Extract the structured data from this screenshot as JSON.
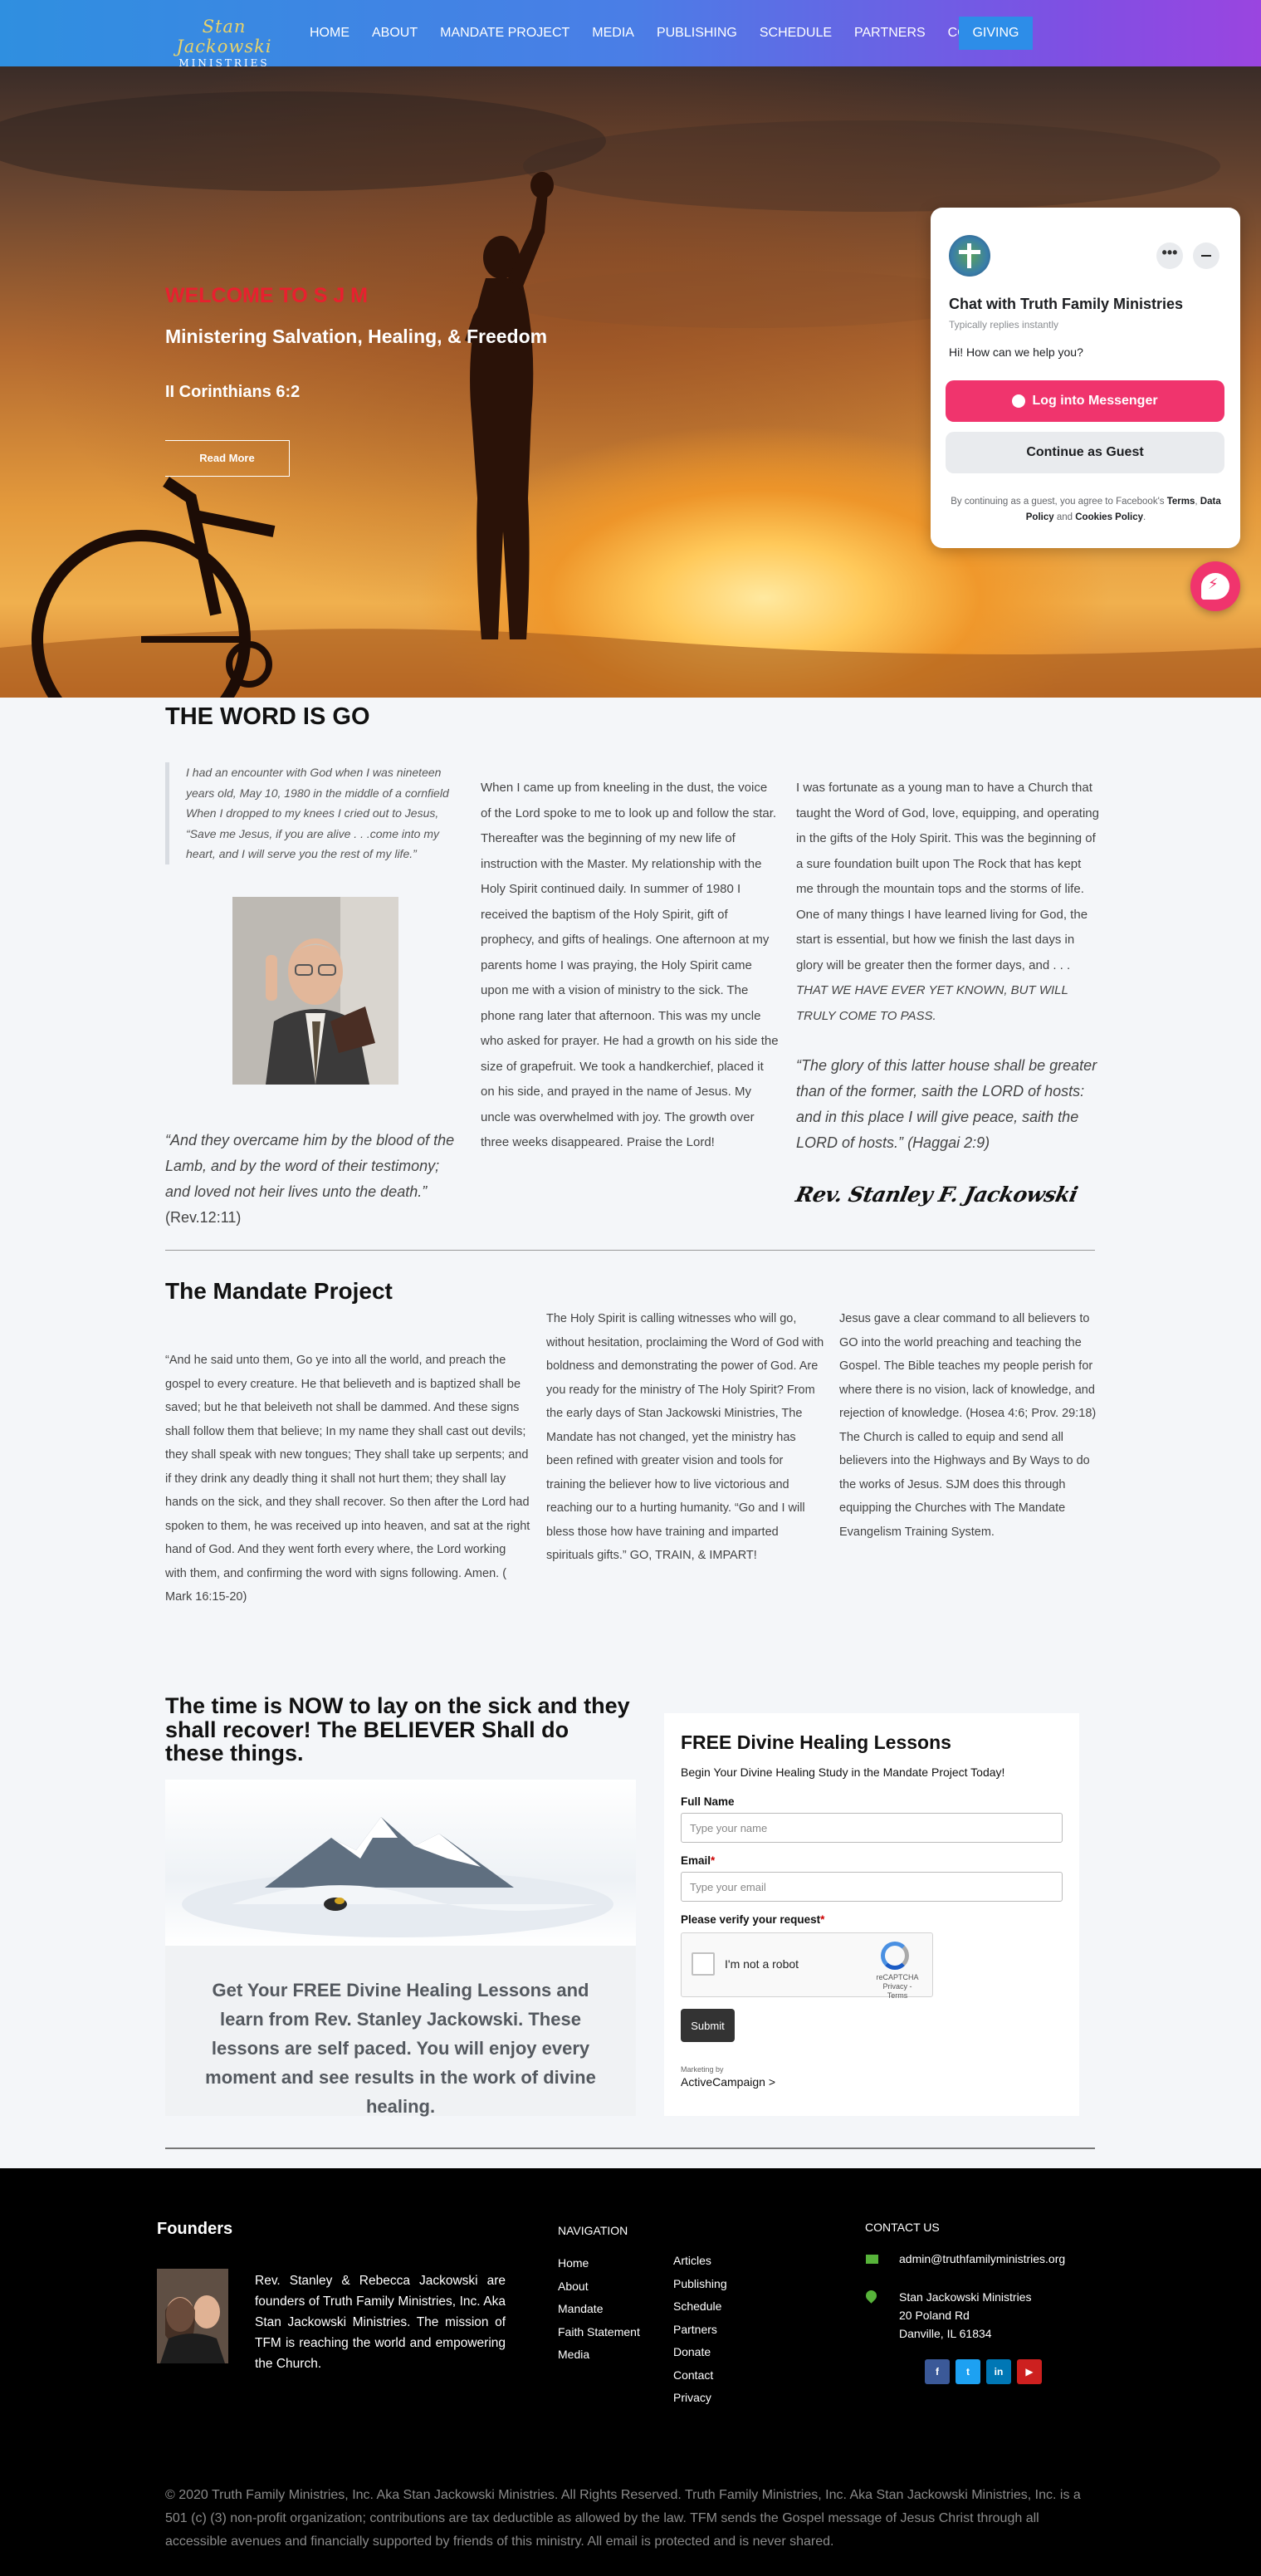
{
  "nav": {
    "logo_script": "Stan Jackowski",
    "logo_sub": "MINISTRIES",
    "items": [
      "HOME",
      "ABOUT",
      "MANDATE PROJECT",
      "MEDIA",
      "PUBLISHING",
      "SCHEDULE",
      "PARTNERS",
      "CONTACT"
    ],
    "giving": "GIVING"
  },
  "hero": {
    "welcome": "WELCOME TO S J M",
    "title": "Ministering Salvation, Healing, & Freedom",
    "verse": "II Corinthians 6:2",
    "button": "Read More"
  },
  "chat": {
    "name": "Chat with Truth Family Ministries",
    "status": "Typically replies instantly",
    "greeting": "Hi! How can we help you?",
    "login": "Log into Messenger",
    "guest": "Continue as Guest",
    "legal_prefix": "By continuing as a guest, you agree to Facebook's",
    "terms": "Terms",
    "data_policy": "Data Policy",
    "and": "and",
    "cookies": "Cookies Policy",
    "dots": "•••"
  },
  "word": {
    "heading": "THE WORD IS GO",
    "quote": "I had an encounter with God when I was nineteen years old, May 10, 1980 in the middle of a cornfield When I dropped to my knees I cried out to Jesus, “Save me Jesus, if you are alive . . .come into my heart, and I will serve you the rest of my life.”",
    "rev12": "“And they overcame him by the blood of the Lamb, and by the word of their testimony; and loved not heir lives unto the death.”",
    "rev12_ref": "(Rev.12:11)",
    "middle": "When I came  up from kneeling in the dust, the voice of the Lord spoke to me to look up and follow the star. Thereafter was the beginning of my new life of instruction with the Master.  My relationship with the Holy Spirit continued daily. In summer of 1980 I received the baptism of the Holy Spirit, gift of prophecy, and gifts of healings.  One afternoon at my parents home I was praying, the Holy Spirit came upon me with a vision of ministry to the sick. The phone rang later that afternoon. This was my uncle who asked for prayer. He had a growth on his side the size of grapefruit.  We took a handkerchief, placed it on his side, and prayed in the name of Jesus.  My uncle was overwhelmed with joy.  The growth over three weeks disappeared.  Praise the Lord!",
    "right": "I was fortunate as a young man to have a Church that taught the Word of God, love, equipping, and operating in the gifts of the Holy Spirit.  This was the beginning of  a sure foundation built upon The Rock that has kept me through the mountain tops and the storms of life. One of many things I have learned living for God, the start is essential, but how we finish the last days in glory will be greater then the former days, and . . .",
    "right_emph": "THAT WE HAVE EVER YET KNOWN, BUT WILL TRULY COME TO PASS.",
    "haggai": "“The glory of this latter house shall be greater than of the former, saith the LORD of hosts: and in this place I will give peace, saith the LORD of hosts.”",
    "haggai_ref": "(Haggai 2:9)",
    "signature": "Rev. Stanley F. Jackowski"
  },
  "mandate": {
    "heading": "The Mandate Project",
    "left": "“And he said unto them,  Go ye into all the world, and preach the gospel to every creature.  He that believeth and is baptized shall be saved; but he that beleiveth not shall be dammed. And these signs shall follow them that believe; In my name they shall cast out devils; they shall speak with new tongues; They shall take up serpents; and if they drink any deadly thing it shall not hurt them; they shall lay hands on the sick, and they shall recover.  So then after the Lord had spoken to them, he was received up into heaven, and sat at the right hand of God. And they went forth every where, the Lord working with them, and confirming the word with signs following. Amen. ( Mark 16:15-20)",
    "middle": "The Holy Spirit is calling witnesses who will go, without hesitation, proclaiming the Word of God with boldness and demonstrating the power of God. Are you ready for the ministry of The Holy Spirit? From the early days of Stan Jackowski Ministries, The Mandate has not changed, yet the ministry has been refined with greater vision and tools for training the believer how to live victorious and reaching our to a hurting humanity. “Go and I will bless those how have training and imparted spirituals gifts.” GO, TRAIN, & IMPART!",
    "right": "Jesus gave a clear command to all believers to GO into the world  preaching and teaching the Gospel.  The Bible teaches  my people perish for where there is no vision, lack of knowledge, and rejection of knowledge.  (Hosea 4:6; Prov. 29:18)   The Church is called to equip and send all believers into the Highways and By Ways to do the works of Jesus. SJM does this through equipping the Churches with The Mandate Evangelism Training System."
  },
  "healing": {
    "heading": "The time is NOW to lay on the sick and they shall recover! The BELIEVER Shall do these things.",
    "promo": "Get Your FREE Divine Healing Lessons and learn from Rev. Stanley Jackowski. These lessons are self paced. You will enjoy every moment and see results in the work of divine healing.",
    "form": {
      "title": "FREE Divine Healing Lessons",
      "lead": "Begin Your Divine Healing Study in the Mandate Project Today!",
      "name_label": "Full Name",
      "name_placeholder": "Type your name",
      "email_label": "Email",
      "email_placeholder": "Type your email",
      "verify_label": "Please verify your request",
      "required_mark": "*",
      "captcha_text": "I'm not a robot",
      "captcha_brand": "reCAPTCHA",
      "captcha_links": "Privacy - Terms",
      "submit": "Submit",
      "marketing": "Marketing by",
      "provider": "ActiveCampaign >"
    }
  },
  "footer": {
    "founders_heading": "Founders",
    "founders_text": "Rev. Stanley & Rebecca Jackowski are founders of Truth Family Ministries, Inc. Aka Stan Jackowski Ministries. The mission of TFM is reaching the world and empowering the Church.",
    "nav_heading": "NAVIGATION",
    "nav_col1": [
      "Home",
      "About",
      "Mandate",
      "Faith Statement",
      "Media"
    ],
    "nav_col2": [
      "Articles",
      "Publishing",
      "Schedule",
      "Partners",
      "Donate",
      "Contact",
      "Privacy"
    ],
    "contact_heading": "CONTACT US",
    "email": "admin@truthfamilyministries.org",
    "address": [
      "Stan Jackowski Ministries",
      "20 Poland Rd",
      "Danville, IL 61834"
    ],
    "socials": [
      {
        "icon": "facebook-icon",
        "glyph": "f",
        "color": "#3b5998"
      },
      {
        "icon": "twitter-icon",
        "glyph": "t",
        "color": "#1da1f2"
      },
      {
        "icon": "linkedin-icon",
        "glyph": "in",
        "color": "#0077b5"
      },
      {
        "icon": "youtube-icon",
        "glyph": "▶",
        "color": "#cd201f"
      }
    ],
    "copyright": "© 2020 Truth Family Ministries, Inc. Aka Stan Jackowski Ministries. All Rights Reserved. Truth Family Ministries, Inc. Aka Stan Jackowski Ministries, Inc. is a 501 (c) (3) non-profit organization; contributions are tax deductible as allowed by the law. TFM sends the Gospel message of Jesus Christ through all accessible avenues and financially supported by friends of this ministry.  All email is protected and is never shared."
  }
}
